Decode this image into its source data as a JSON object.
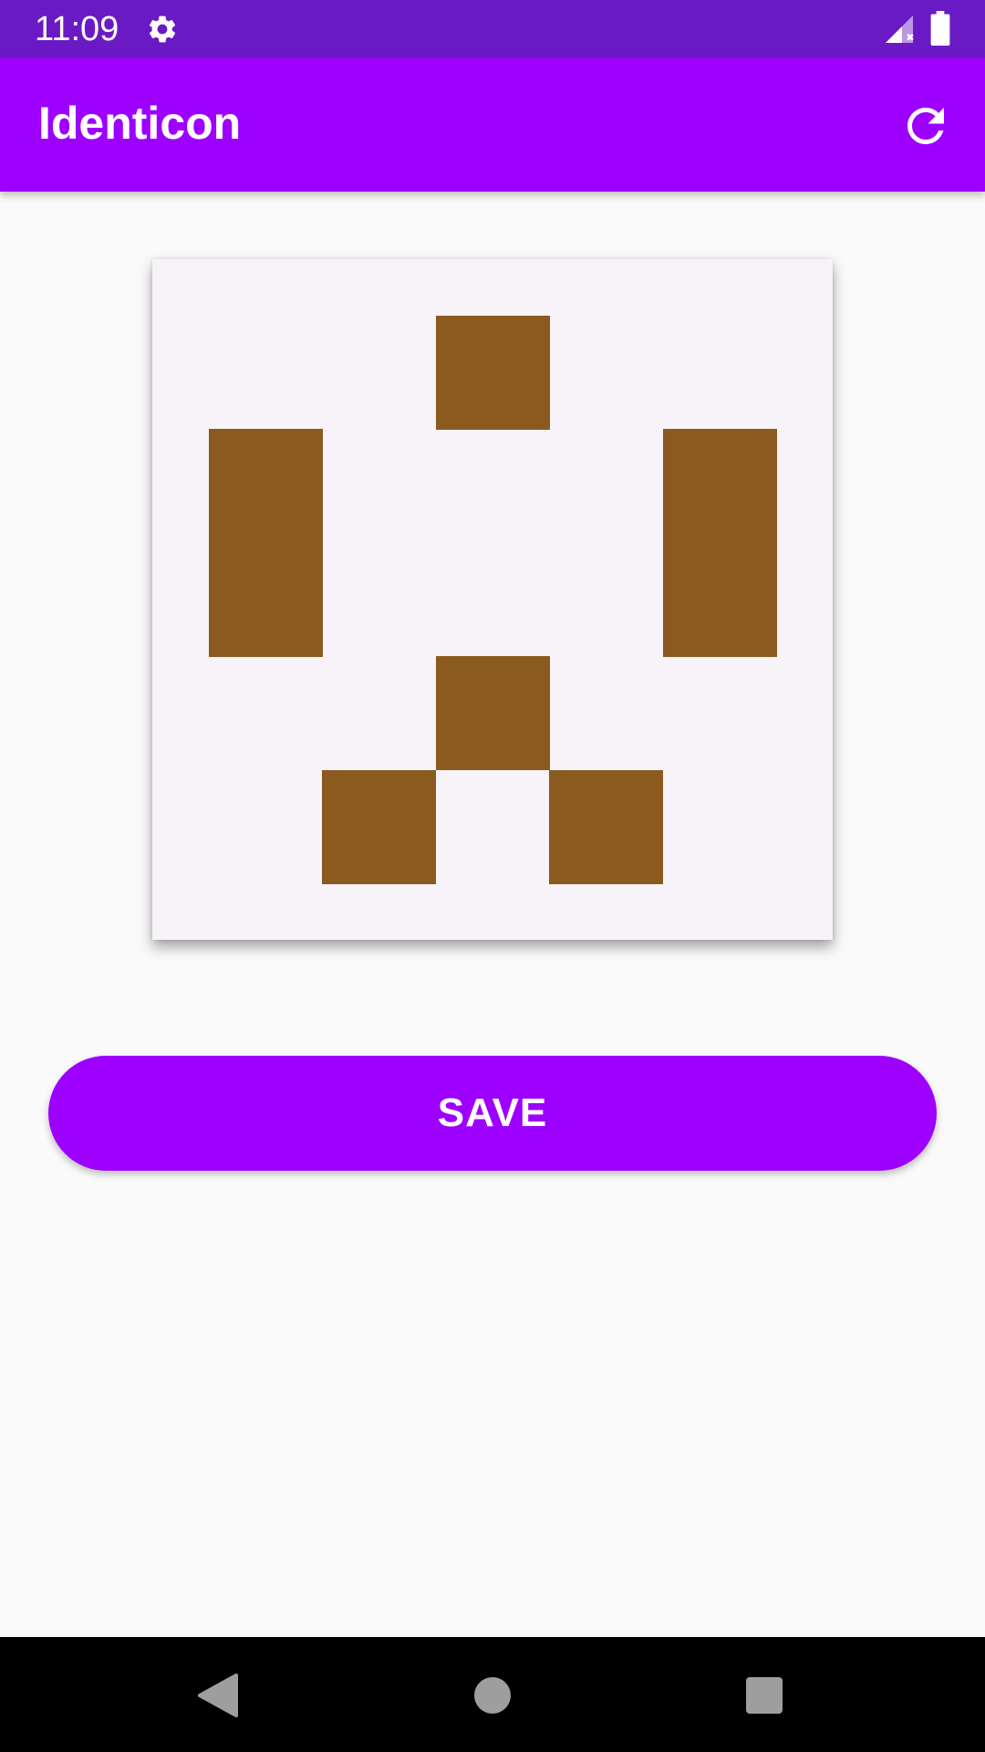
{
  "status_bar": {
    "time": "11:09",
    "icons": [
      "gear-icon",
      "signal-icon",
      "battery-icon"
    ]
  },
  "app_bar": {
    "title": "Identicon",
    "action_icon": "refresh-icon"
  },
  "identicon": {
    "color": "#8a5a1e",
    "background": "#f8f3f8",
    "grid_size": 5,
    "grid": [
      [
        0,
        0,
        1,
        0,
        0
      ],
      [
        1,
        0,
        0,
        0,
        1
      ],
      [
        1,
        0,
        0,
        0,
        1
      ],
      [
        0,
        0,
        1,
        0,
        0
      ],
      [
        0,
        1,
        0,
        1,
        0
      ]
    ]
  },
  "save_button": {
    "label": "SAVE"
  },
  "nav_bar": {
    "icons": [
      "back-icon",
      "home-icon",
      "recents-icon"
    ]
  },
  "colors": {
    "status_bar": "#6a1ac4",
    "app_bar": "#9e00ff",
    "accent": "#9e00ff",
    "page_background": "#fafafa"
  }
}
